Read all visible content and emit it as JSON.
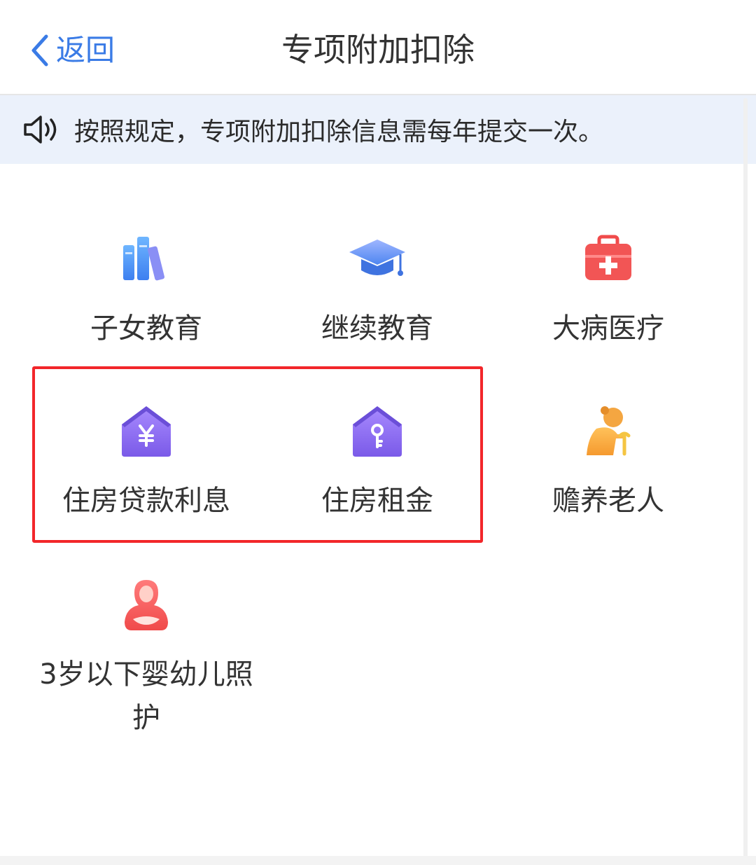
{
  "header": {
    "back_label": "返回",
    "title": "专项附加扣除"
  },
  "notice": {
    "text": "按照规定，专项附加扣除信息需每年提交一次。"
  },
  "items": [
    {
      "label": "子女教育",
      "icon": "books-icon"
    },
    {
      "label": "继续教育",
      "icon": "graduation-cap-icon"
    },
    {
      "label": "大病医疗",
      "icon": "medical-kit-icon"
    },
    {
      "label": "住房贷款利息",
      "icon": "house-yen-icon"
    },
    {
      "label": "住房租金",
      "icon": "house-key-icon"
    },
    {
      "label": "赡养老人",
      "icon": "elderly-person-icon"
    },
    {
      "label": "3岁以下婴幼儿照护",
      "icon": "mother-baby-icon"
    }
  ],
  "colors": {
    "accent": "#3a7be6",
    "highlight_border": "#f2262a",
    "notice_bg": "#ebf1fb",
    "purple_icon": "#8a6cf0",
    "red_icon": "#f04b4b",
    "orange_icon": "#f6a63a"
  }
}
